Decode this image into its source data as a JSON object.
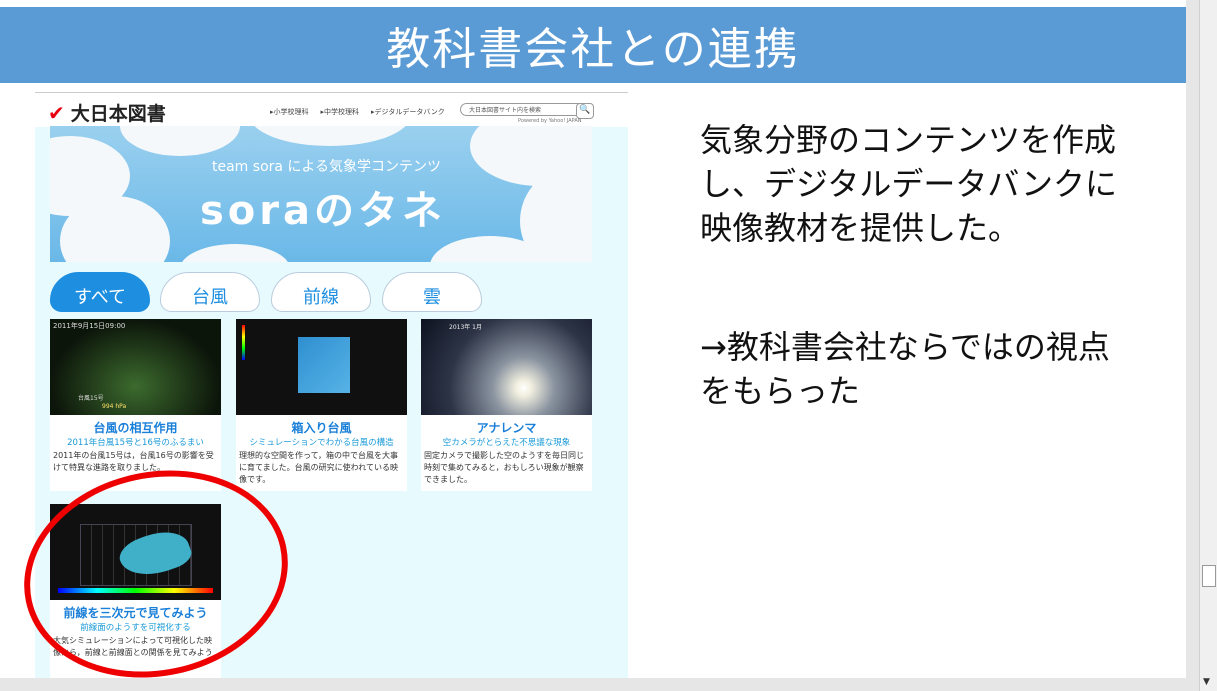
{
  "slide": {
    "title": "教科書会社との連携",
    "body_1": "気象分野のコンテンツを作成し、デジタルデータバンクに映像教材を提供した。",
    "body_2": "→教科書会社ならではの視点をもらった"
  },
  "site": {
    "logo": "大日本図書",
    "nav": [
      "▸小学校理科",
      "▸中学校理科",
      "▸デジタルデータバンク"
    ],
    "search_placeholder": "大日本図書サイト内を検索",
    "powered": "Powered by Yahoo! JAPAN",
    "hero_sub": "team sora による気象学コンテンツ",
    "hero_main": "soraのタネ",
    "tabs": [
      "すべて",
      "台風",
      "前線",
      "雲"
    ],
    "cards": [
      {
        "stamp": "2011年9月15日09:00",
        "label": "台風15号",
        "pressure": "994 hPa",
        "title": "台風の相互作用",
        "sub": "2011年台風15号と16号のふるまい",
        "desc": "2011年の台風15号は，台風16号の影響を受けて特異な進路を取りました。"
      },
      {
        "title": "箱入り台風",
        "sub": "シミュレーションでわかる台風の構造",
        "desc": "理想的な空間を作って，箱の中で台風を大事に育てました。台風の研究に使われている映像です。"
      },
      {
        "stamp": "2013年 1月",
        "title": "アナレンマ",
        "sub": "空カメラがとらえた不思議な現象",
        "desc": "固定カメラで撮影した空のようすを毎日同じ時刻で集めてみると，おもしろい現象が観察できました。"
      },
      {
        "title": "前線を三次元で見てみよう",
        "sub": "前線面のようすを可視化する",
        "desc": "大気シミュレーションによって可視化した映像から，前線と前線面との関係を見てみよう"
      }
    ]
  },
  "colors": {
    "title_bar": "#5b9bd5",
    "accent": "#1d8ee0",
    "highlight_ring": "#e00000"
  }
}
